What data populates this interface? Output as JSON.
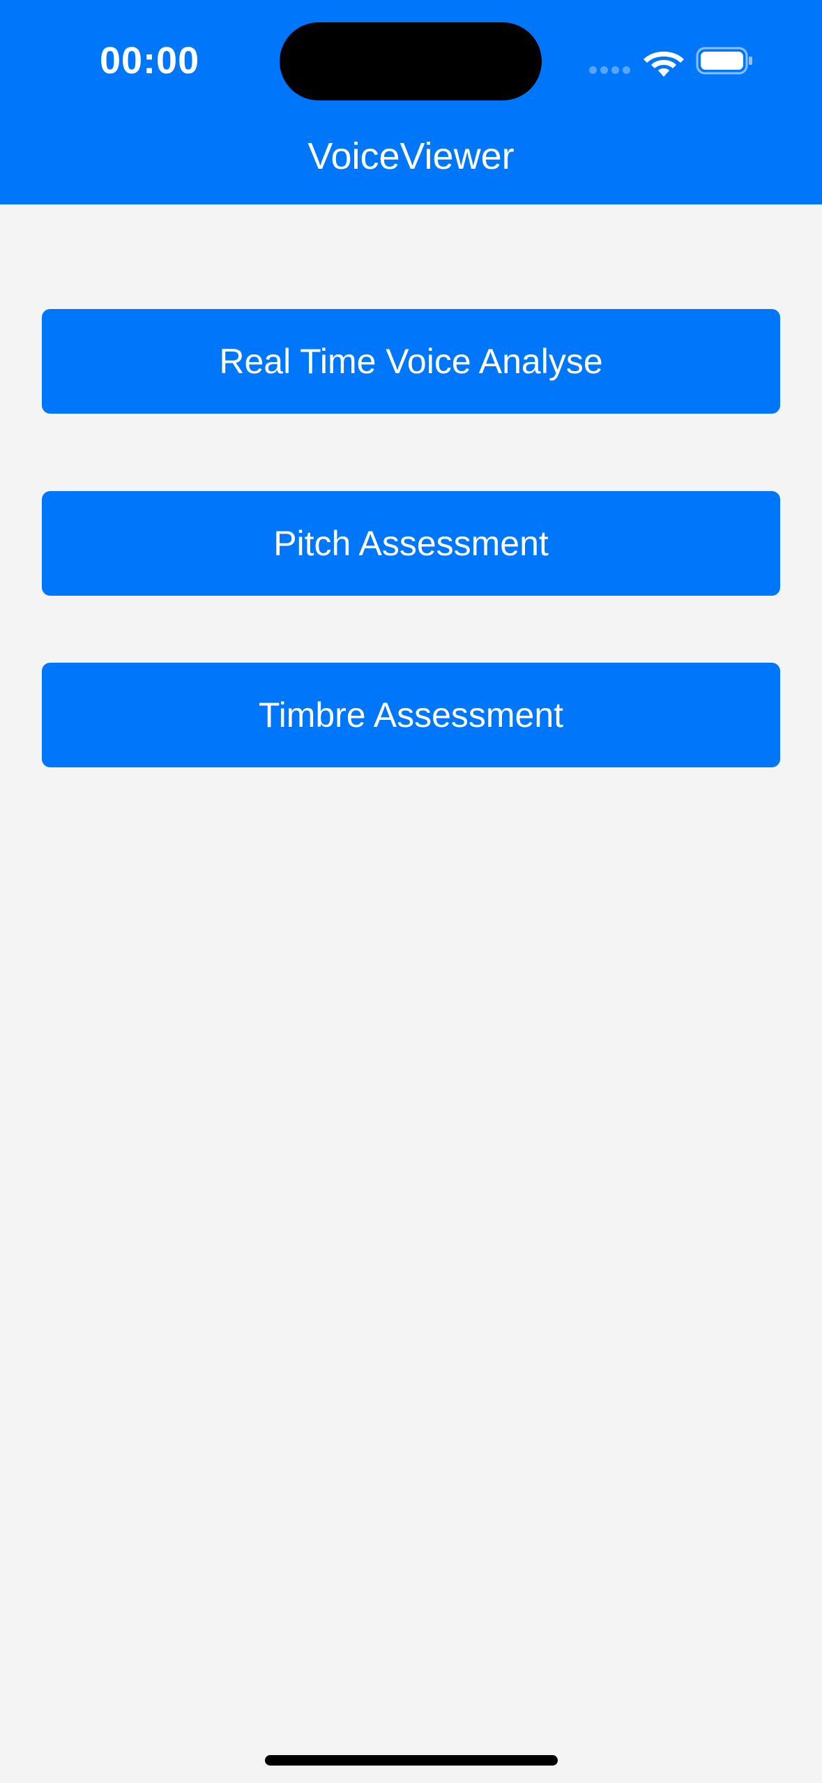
{
  "status_bar": {
    "time": "00:00",
    "icons": [
      "signal-dots-icon",
      "wifi-icon",
      "battery-icon"
    ]
  },
  "header": {
    "title": "VoiceViewer"
  },
  "menu": {
    "realtime_label": "Real Time Voice Analyse",
    "pitch_label": "Pitch Assessment",
    "timbre_label": "Timbre Assessment"
  },
  "colors": {
    "accent": "#0077fb",
    "background": "#f4f4f4",
    "text_on_accent": "#ffffff"
  }
}
